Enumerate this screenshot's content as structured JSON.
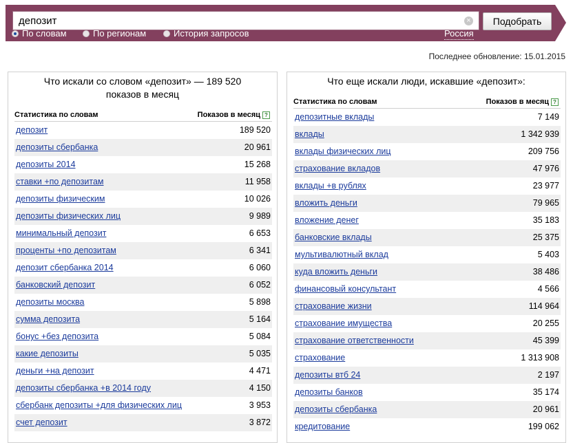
{
  "search": {
    "query": "депозит",
    "submit_label": "Подобрать",
    "clear_symbol": "×"
  },
  "tabs": [
    {
      "label": "По словам",
      "selected": true
    },
    {
      "label": "По регионам",
      "selected": false
    },
    {
      "label": "История запросов",
      "selected": false
    }
  ],
  "region": "Россия",
  "last_update": "Последнее обновление: 15.01.2015",
  "colors": {
    "header_bg": "#83405e",
    "link": "#1b3b9c",
    "row_stripe": "#efefef"
  },
  "left_panel": {
    "title_line1": "Что искали со словом «депозит» — 189 520",
    "title_line2": "показов в месяц",
    "col_word": "Статистика по словам",
    "col_count": "Показов в месяц",
    "help_icon": "?",
    "rows": [
      {
        "phrase": "депозит",
        "count": "189 520"
      },
      {
        "phrase": "депозиты сбербанка",
        "count": "20 961"
      },
      {
        "phrase": "депозиты 2014",
        "count": "15 268"
      },
      {
        "phrase": "ставки +по депозитам",
        "count": "11 958"
      },
      {
        "phrase": "депозиты физическим",
        "count": "10 026"
      },
      {
        "phrase": "депозиты физических лиц",
        "count": "9 989"
      },
      {
        "phrase": "минимальный депозит",
        "count": "6 653"
      },
      {
        "phrase": "проценты +по депозитам",
        "count": "6 341"
      },
      {
        "phrase": "депозит сбербанка 2014",
        "count": "6 060"
      },
      {
        "phrase": "банковский депозит",
        "count": "6 052"
      },
      {
        "phrase": "депозиты москва",
        "count": "5 898"
      },
      {
        "phrase": "сумма депозита",
        "count": "5 164"
      },
      {
        "phrase": "бонус +без депозита",
        "count": "5 084"
      },
      {
        "phrase": "какие депозиты",
        "count": "5 035"
      },
      {
        "phrase": "деньги +на депозит",
        "count": "4 471"
      },
      {
        "phrase": "депозиты сбербанка +в 2014 году",
        "count": "4 150"
      },
      {
        "phrase": "сбербанк депозиты +для физических лиц",
        "count": "3 953"
      },
      {
        "phrase": "счет депозит",
        "count": "3 872"
      }
    ]
  },
  "right_panel": {
    "title": "Что еще искали люди, искавшие «депозит»:",
    "col_word": "Статистика по словам",
    "col_count": "Показов в месяц",
    "help_icon": "?",
    "rows": [
      {
        "phrase": "депозитные вклады",
        "count": "7 149"
      },
      {
        "phrase": "вклады",
        "count": "1 342 939"
      },
      {
        "phrase": "вклады физических лиц",
        "count": "209 756"
      },
      {
        "phrase": "страхование вкладов",
        "count": "47 976"
      },
      {
        "phrase": "вклады +в рублях",
        "count": "23 977"
      },
      {
        "phrase": "вложить деньги",
        "count": "79 965"
      },
      {
        "phrase": "вложение денег",
        "count": "35 183"
      },
      {
        "phrase": "банковские вклады",
        "count": "25 375"
      },
      {
        "phrase": "мультивалютный вклад",
        "count": "5 403"
      },
      {
        "phrase": "куда вложить деньги",
        "count": "38 486"
      },
      {
        "phrase": "финансовый консультант",
        "count": "4 566"
      },
      {
        "phrase": "страхование жизни",
        "count": "114 964"
      },
      {
        "phrase": "страхование имущества",
        "count": "20 255"
      },
      {
        "phrase": "страхование ответственности",
        "count": "45 399"
      },
      {
        "phrase": "страхование",
        "count": "1 313 908"
      },
      {
        "phrase": "депозиты втб 24",
        "count": "2 197"
      },
      {
        "phrase": "депозиты банков",
        "count": "35 174"
      },
      {
        "phrase": "депозиты сбербанка",
        "count": "20 961"
      },
      {
        "phrase": "кредитование",
        "count": "199 062"
      }
    ]
  }
}
